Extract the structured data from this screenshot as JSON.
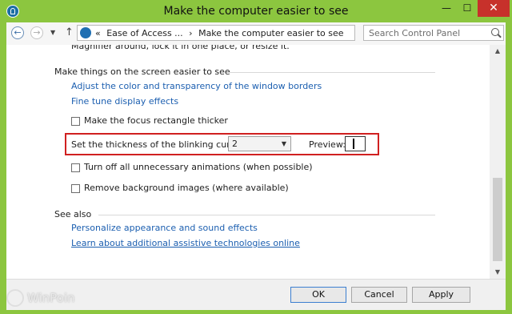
{
  "window": {
    "title": "Make the computer easier to see",
    "minimize": "—",
    "maximize": "☐",
    "close": "✕"
  },
  "nav": {
    "breadcrumb_prefix": "«",
    "breadcrumbs": [
      "Ease of Access ...",
      "›",
      "Make the computer easier to see"
    ],
    "search_placeholder": "Search Control Panel"
  },
  "content": {
    "cut_text": "Magnifier around, lock it in one place, or resize it.",
    "section_screen": {
      "heading": "Make things on the screen easier to see",
      "links": [
        "Adjust the color and transparency of the window borders",
        "Fine tune display effects"
      ],
      "focus_checkbox": "Make the focus rectangle thicker",
      "cursor_label": "Set the thickness of the blinking cursor:",
      "cursor_value": "2",
      "preview_label": "Preview:",
      "animations_checkbox": "Turn off all unnecessary animations (when possible)",
      "background_checkbox": "Remove background images (where available)"
    },
    "see_also": {
      "heading": "See also",
      "links": [
        "Personalize appearance and sound effects",
        "Learn about additional assistive technologies online"
      ]
    }
  },
  "footer": {
    "ok": "OK",
    "cancel": "Cancel",
    "apply": "Apply"
  },
  "watermark": "WinPoin",
  "colors": {
    "accent": "#8cc63f",
    "link": "#1c5fb0",
    "highlight": "#d02020",
    "close": "#c7312b"
  }
}
